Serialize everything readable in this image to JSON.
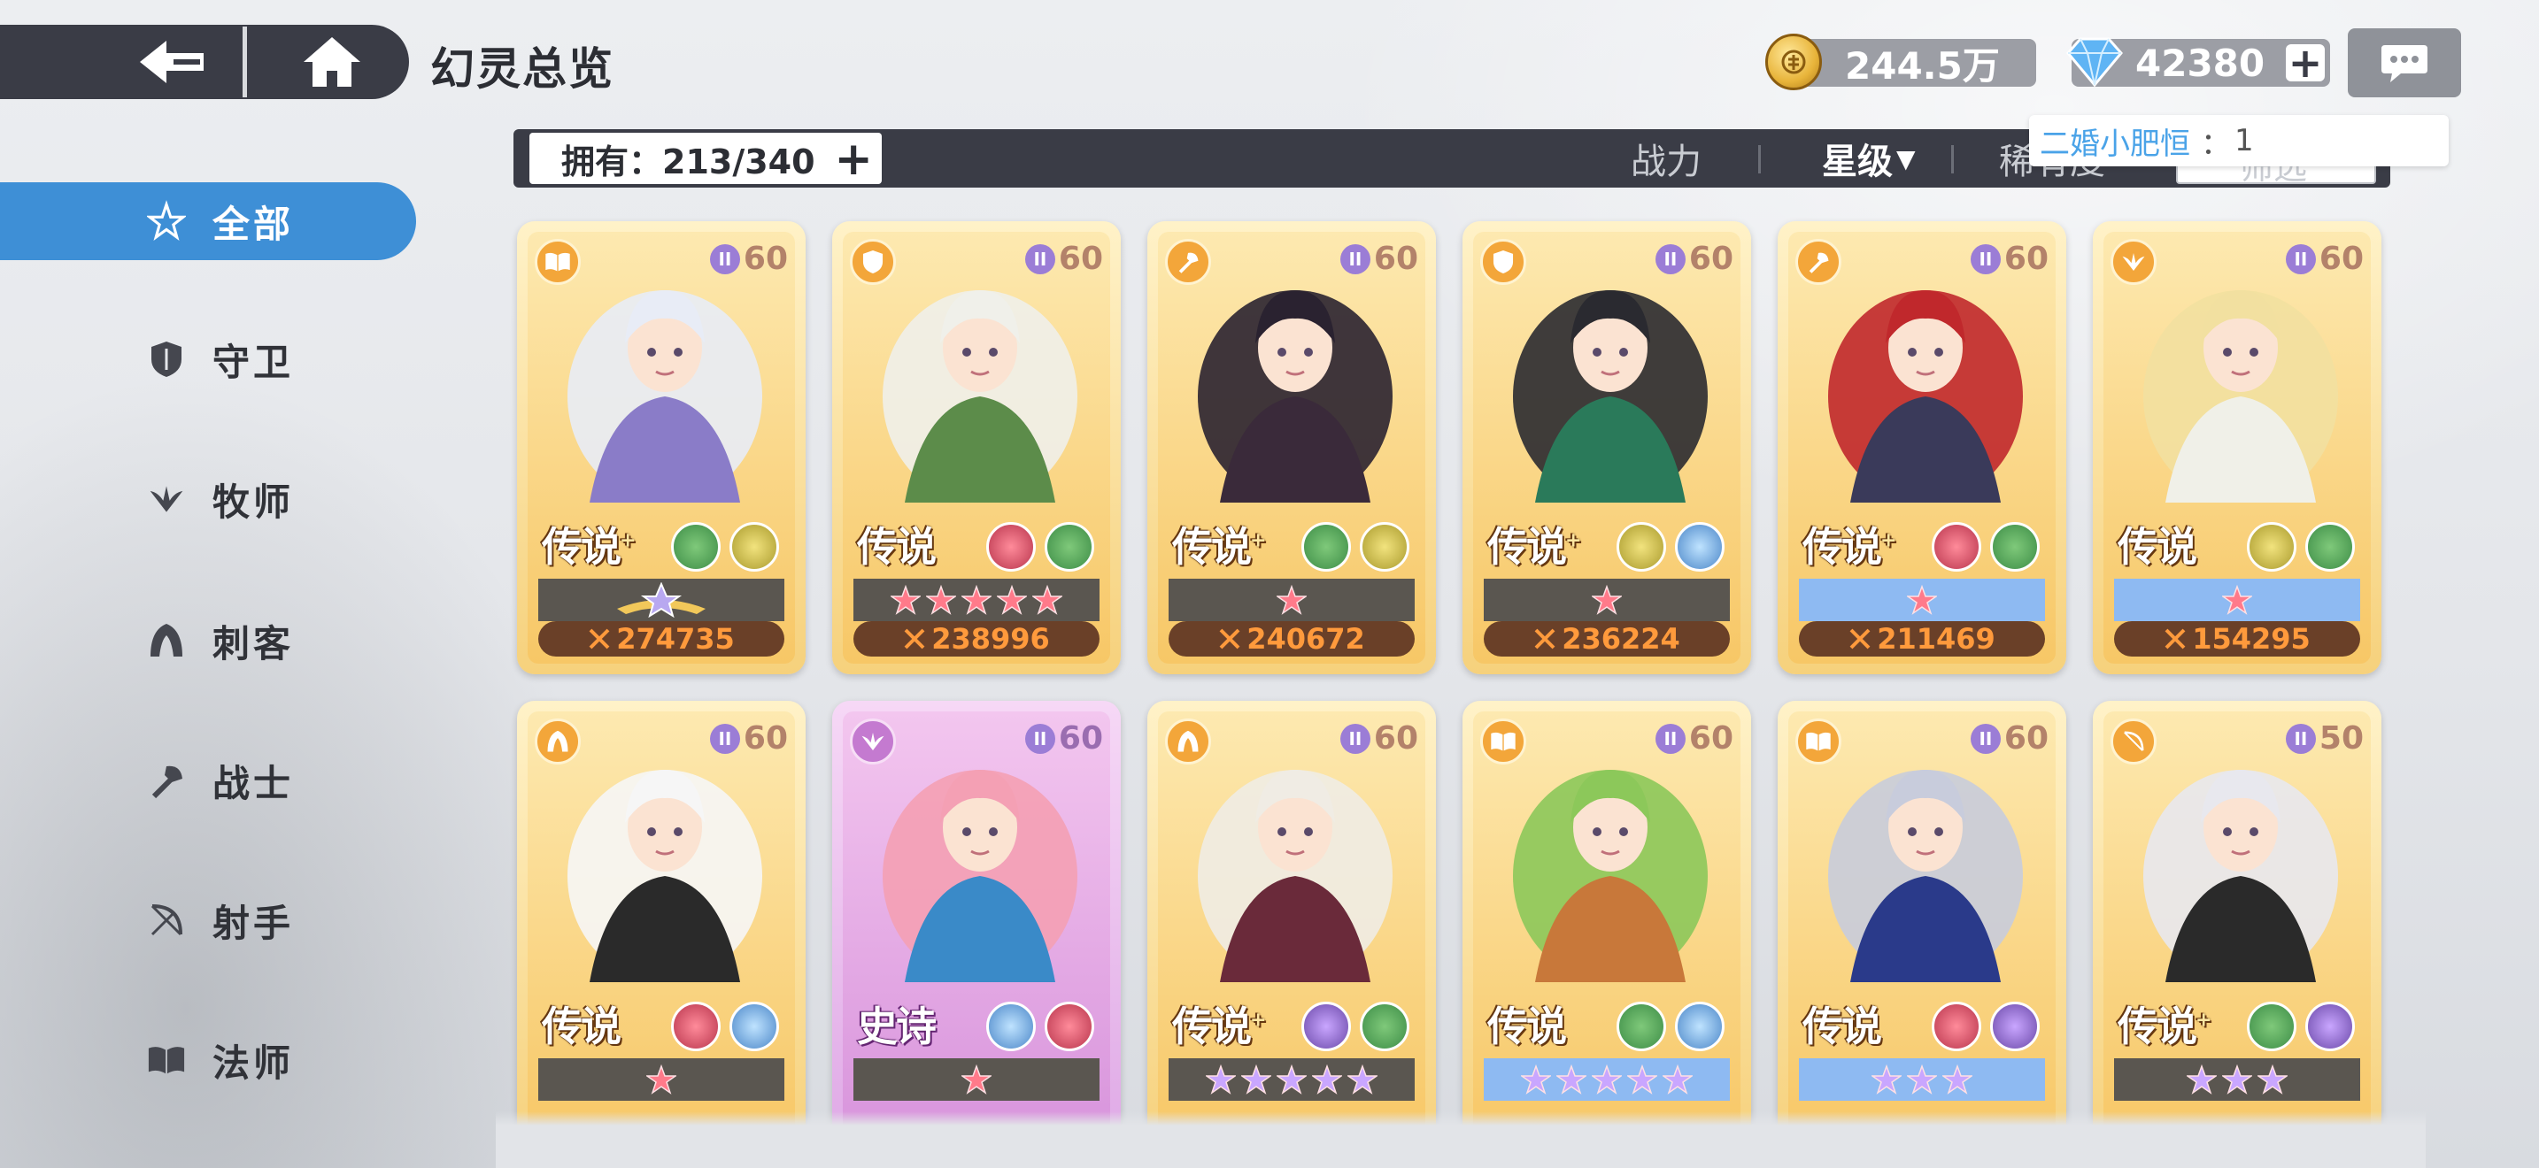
{
  "header": {
    "title": "幻灵总览",
    "back_icon": "back-arrow-icon",
    "home_icon": "home-icon"
  },
  "resources": {
    "gold": "244.5万",
    "gems": "42380",
    "gem_plus": "+"
  },
  "tooltip": {
    "name": "二婚小肥恒",
    "separator": "：",
    "count": "1"
  },
  "sidebar": {
    "items": [
      {
        "label": "全部",
        "icon": "star-all-icon",
        "active": true
      },
      {
        "label": "守卫",
        "icon": "shield-icon",
        "active": false
      },
      {
        "label": "牧师",
        "icon": "wings-icon",
        "active": false
      },
      {
        "label": "刺客",
        "icon": "hood-icon",
        "active": false
      },
      {
        "label": "战士",
        "icon": "axe-icon",
        "active": false
      },
      {
        "label": "射手",
        "icon": "bow-icon",
        "active": false
      },
      {
        "label": "法师",
        "icon": "book-icon",
        "active": false
      }
    ]
  },
  "filter": {
    "own_label": "拥有：213/340",
    "own_plus": "+",
    "sort_power": "战力",
    "sort_star": "星级",
    "sort_star_arrow": "▼",
    "sort_rarity": "稀有度",
    "filter_btn": "筛选"
  },
  "colors": {
    "accent": "#3e8fd6",
    "bar": "#3a3c46",
    "power_text": "#ff9a3c"
  },
  "cards": [
    {
      "rarity": "传说",
      "plus": "+",
      "tier": "II",
      "level": "60",
      "role": "book",
      "elements": [
        "nature",
        "holy"
      ],
      "stars": 0,
      "star_style": "crown",
      "power": "274735",
      "epic": false
    },
    {
      "rarity": "传说",
      "plus": "",
      "tier": "II",
      "level": "60",
      "role": "shield",
      "elements": [
        "chaos",
        "nature"
      ],
      "stars": 5,
      "star_style": "dark",
      "power": "238996",
      "epic": false
    },
    {
      "rarity": "传说",
      "plus": "+",
      "tier": "II",
      "level": "60",
      "role": "axe",
      "elements": [
        "nature",
        "holy"
      ],
      "stars": 1,
      "star_style": "dark",
      "power": "240672",
      "epic": false
    },
    {
      "rarity": "传说",
      "plus": "+",
      "tier": "II",
      "level": "60",
      "role": "shield",
      "elements": [
        "holy",
        "ice"
      ],
      "stars": 1,
      "star_style": "dark",
      "power": "236224",
      "epic": false
    },
    {
      "rarity": "传说",
      "plus": "+",
      "tier": "II",
      "level": "60",
      "role": "axe",
      "elements": [
        "chaos",
        "nature"
      ],
      "stars": 1,
      "star_style": "blue",
      "power": "211469",
      "epic": false
    },
    {
      "rarity": "传说",
      "plus": "",
      "tier": "II",
      "level": "60",
      "role": "wings",
      "elements": [
        "holy",
        "nature"
      ],
      "stars": 1,
      "star_style": "blue",
      "power": "154295",
      "epic": false
    },
    {
      "rarity": "传说",
      "plus": "",
      "tier": "II",
      "level": "60",
      "role": "hood",
      "elements": [
        "chaos",
        "ice"
      ],
      "stars": 1,
      "star_style": "dark",
      "power": "",
      "epic": false
    },
    {
      "rarity": "史诗",
      "plus": "",
      "tier": "II",
      "level": "60",
      "role": "wings",
      "elements": [
        "ice",
        "chaos"
      ],
      "stars": 1,
      "star_style": "dark",
      "power": "",
      "epic": true
    },
    {
      "rarity": "传说",
      "plus": "+",
      "tier": "II",
      "level": "60",
      "role": "hood",
      "elements": [
        "void",
        "nature"
      ],
      "stars": 5,
      "star_style": "purple",
      "power": "",
      "epic": false
    },
    {
      "rarity": "传说",
      "plus": "",
      "tier": "II",
      "level": "60",
      "role": "book",
      "elements": [
        "nature",
        "ice"
      ],
      "stars": 5,
      "star_style": "purple-blue",
      "power": "",
      "epic": false
    },
    {
      "rarity": "传说",
      "plus": "",
      "tier": "II",
      "level": "60",
      "role": "book",
      "elements": [
        "chaos",
        "void"
      ],
      "stars": 3,
      "star_style": "purple-blue",
      "power": "",
      "epic": false
    },
    {
      "rarity": "传说",
      "plus": "+",
      "tier": "II",
      "level": "50",
      "role": "bow",
      "elements": [
        "nature",
        "void"
      ],
      "stars": 3,
      "star_style": "purple",
      "power": "",
      "epic": false
    }
  ]
}
